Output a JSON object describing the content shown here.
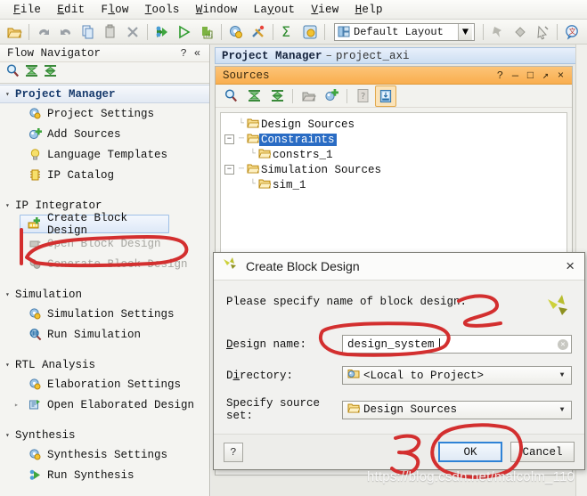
{
  "menubar": {
    "items": [
      {
        "label": "File",
        "accel": "F"
      },
      {
        "label": "Edit",
        "accel": "E"
      },
      {
        "label": "Flow",
        "accel": "l"
      },
      {
        "label": "Tools",
        "accel": "T"
      },
      {
        "label": "Window",
        "accel": "W"
      },
      {
        "label": "Layout",
        "accel": "y"
      },
      {
        "label": "View",
        "accel": "V"
      },
      {
        "label": "Help",
        "accel": "H"
      }
    ]
  },
  "toolbar": {
    "layout_combo_value": "Default Layout",
    "icons": [
      "open-project-icon",
      "undo-icon",
      "redo-icon",
      "copy-icon",
      "paste-icon",
      "delete-icon",
      "run-synthesis-icon",
      "run-implementation-icon",
      "generate-bitstream-icon",
      "settings-icon",
      "tools-icon",
      "report-sum-icon",
      "project-settings-icon"
    ],
    "right_icons": [
      "pin-icon",
      "diamond-icon",
      "arrow-select-icon",
      "language-icon"
    ]
  },
  "flow_navigator": {
    "title": "Flow Navigator",
    "help_glyph": "?",
    "collapse_glyph": "«",
    "tools": [
      "search-icon",
      "collapse-all-icon",
      "expand-all-icon"
    ],
    "sections": [
      {
        "name": "Project Manager",
        "highlighted": true,
        "items": [
          {
            "label": "Project Settings",
            "icon": "gear-settings-icon",
            "state": "normal"
          },
          {
            "label": "Add Sources",
            "icon": "add-sources-icon",
            "state": "normal"
          },
          {
            "label": "Language Templates",
            "icon": "lightbulb-icon",
            "state": "normal"
          },
          {
            "label": "IP Catalog",
            "icon": "ip-catalog-icon",
            "state": "normal"
          }
        ]
      },
      {
        "name": "IP Integrator",
        "highlighted": false,
        "items": [
          {
            "label": "Create Block Design",
            "icon": "create-block-design-icon",
            "state": "selected"
          },
          {
            "label": "Open Block Design",
            "icon": "open-block-design-icon",
            "state": "disabled"
          },
          {
            "label": "Generate Block Design",
            "icon": "generate-block-design-icon",
            "state": "disabled"
          }
        ]
      },
      {
        "name": "Simulation",
        "highlighted": false,
        "items": [
          {
            "label": "Simulation Settings",
            "icon": "gear-settings-icon",
            "state": "normal"
          },
          {
            "label": "Run Simulation",
            "icon": "run-simulation-icon",
            "state": "normal"
          }
        ]
      },
      {
        "name": "RTL Analysis",
        "highlighted": false,
        "items": [
          {
            "label": "Elaboration Settings",
            "icon": "gear-settings-icon",
            "state": "normal"
          },
          {
            "label": "Open Elaborated Design",
            "icon": "open-elaborated-design-icon",
            "state": "normal",
            "expander": "▸"
          }
        ]
      },
      {
        "name": "Synthesis",
        "highlighted": false,
        "items": [
          {
            "label": "Synthesis Settings",
            "icon": "gear-settings-icon",
            "state": "normal"
          },
          {
            "label": "Run Synthesis",
            "icon": "run-synthesis-icon",
            "state": "normal"
          }
        ]
      }
    ]
  },
  "project_manager": {
    "title": "Project Manager",
    "dash": "–",
    "project_name": "project_axi"
  },
  "sources_panel": {
    "title": "Sources",
    "window_buttons": [
      "?",
      "—",
      "□",
      "↗",
      "×"
    ],
    "tools": [
      "search-icon",
      "collapse-all-icon",
      "expand-all-icon",
      "open-folder-icon",
      "add-sources-icon",
      "help-icon",
      "hierarchy-icon"
    ],
    "tree": [
      {
        "label": "Design Sources",
        "indent": 1,
        "expander": "none",
        "selected": false
      },
      {
        "label": "Constraints",
        "indent": 0,
        "expander": "minus",
        "selected": true
      },
      {
        "label": "constrs_1",
        "indent": 2,
        "expander": "none",
        "selected": false
      },
      {
        "label": "Simulation Sources",
        "indent": 0,
        "expander": "minus",
        "selected": false
      },
      {
        "label": "sim_1",
        "indent": 2,
        "expander": "none",
        "selected": false
      }
    ]
  },
  "dialog": {
    "title": "Create Block Design",
    "close_glyph": "×",
    "prompt": "Please specify name of block design.",
    "fields": {
      "design_name": {
        "label": "Design name:",
        "accel": "D",
        "value": "design_system"
      },
      "directory": {
        "label": "Directory:",
        "accel": "i",
        "value": "<Local to Project>",
        "icon": "local-project-icon"
      },
      "source_set": {
        "label": "Specify source set:",
        "accel": "",
        "value": "Design Sources",
        "icon": "folder-icon"
      }
    },
    "help_button": "?",
    "ok_button": "OK",
    "cancel_button": "Cancel"
  },
  "annotations": {
    "marker_1": "1",
    "marker_2": "2",
    "marker_3": "3",
    "color": "#d32f2f"
  },
  "watermark": {
    "text": "https://blog.csdn.net/malcolm_110"
  }
}
